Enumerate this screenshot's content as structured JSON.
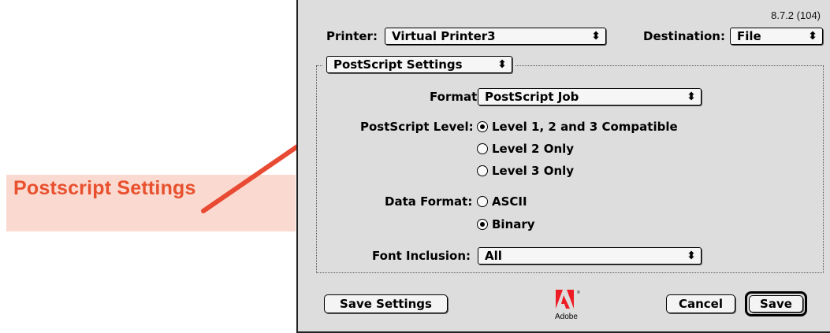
{
  "callout": {
    "text": "Postscript Settings",
    "color": "#e8502e",
    "background": "#fadad0"
  },
  "dialog": {
    "version": "8.7.2 (104)",
    "printer": {
      "label": "Printer:",
      "value": "Virtual Printer3"
    },
    "destination": {
      "label": "Destination:",
      "value": "File"
    },
    "panel": {
      "value": "PostScript Settings"
    },
    "format": {
      "label": "Format:",
      "value": "PostScript Job"
    },
    "postscript_level": {
      "label": "PostScript Level:",
      "options": [
        "Level 1, 2 and 3 Compatible",
        "Level 2 Only",
        "Level 3 Only"
      ],
      "selected": "Level 1, 2 and 3 Compatible"
    },
    "data_format": {
      "label": "Data Format:",
      "options": [
        "ASCII",
        "Binary"
      ],
      "selected": "Binary"
    },
    "font_inclusion": {
      "label": "Font Inclusion:",
      "value": "All"
    },
    "buttons": {
      "save_settings": "Save Settings",
      "cancel": "Cancel",
      "save": "Save"
    },
    "logo": {
      "text": "Adobe",
      "color": "#ed1c24"
    }
  }
}
